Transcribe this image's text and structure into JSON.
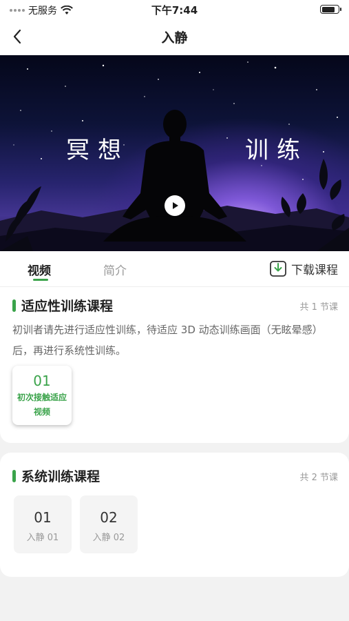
{
  "status_bar": {
    "carrier": "无服务",
    "time": "下午7:44"
  },
  "nav": {
    "title": "入静"
  },
  "hero": {
    "text_left": "冥想",
    "text_right": "训练"
  },
  "tabs": [
    {
      "label": "视频"
    },
    {
      "label": "简介"
    }
  ],
  "download": {
    "label": "下载课程"
  },
  "section1": {
    "title": "适应性训练课程",
    "count": "共 1 节课",
    "description": "初训者请先进行适应性训练，待适应 3D 动态训练画面（无眩晕感）后，再进行系统性训练。",
    "lessons": [
      {
        "num": "01",
        "name": "初次接触适应视频"
      }
    ]
  },
  "section2": {
    "title": "系统训练课程",
    "count": "共 2 节课",
    "lessons": [
      {
        "num": "01",
        "name": "入静 01"
      },
      {
        "num": "02",
        "name": "入静 02"
      }
    ]
  },
  "colors": {
    "accent": "#3aa34a"
  }
}
